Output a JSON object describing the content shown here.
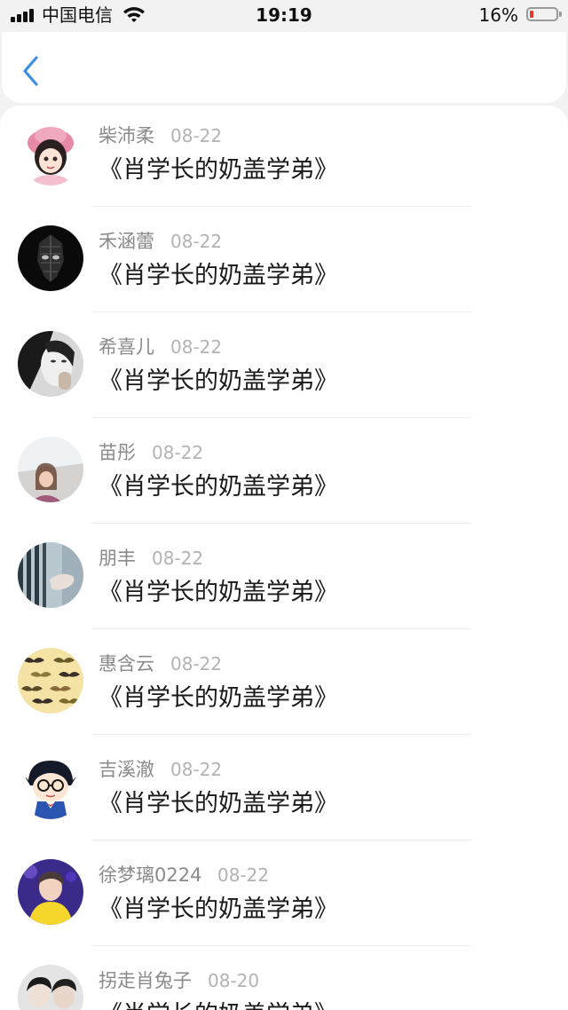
{
  "status_bar": {
    "carrier": "中国电信",
    "time": "19:19",
    "battery_percent": "16%",
    "battery_level": 0.16,
    "battery_color": "#e53935",
    "icons": [
      "signal-icon",
      "wifi-icon",
      "battery-icon"
    ]
  },
  "nav": {
    "back_icon": "chevron-left-icon",
    "accent_color": "#3a8ee6"
  },
  "items": [
    {
      "name": "柴沛柔",
      "date": "08-22",
      "content": "《肖学长的奶盖学弟》",
      "avatar": "cartoon-girl-pink-hat"
    },
    {
      "name": "禾涵蕾",
      "date": "08-22",
      "content": "《肖学长的奶盖学弟》",
      "avatar": "dark-mask-figure"
    },
    {
      "name": "希喜儿",
      "date": "08-22",
      "content": "《肖学长的奶盖学弟》",
      "avatar": "bw-portrait"
    },
    {
      "name": "苗彤",
      "date": "08-22",
      "content": "《肖学长的奶盖学弟》",
      "avatar": "girl-photo"
    },
    {
      "name": "朋丰",
      "date": "08-22",
      "content": "《肖学长的奶盖学弟》",
      "avatar": "hand-blinds-photo"
    },
    {
      "name": "惠含云",
      "date": "08-22",
      "content": "《肖学长的奶盖学弟》",
      "avatar": "mustache-pattern"
    },
    {
      "name": "吉溪澈",
      "date": "08-22",
      "content": "《肖学长的奶盖学弟》",
      "avatar": "cartoon-boy-glasses"
    },
    {
      "name": "徐梦璃0224",
      "date": "08-22",
      "content": "《肖学长的奶盖学弟》",
      "avatar": "yellow-shirt-boy"
    },
    {
      "name": "拐走肖兔子",
      "date": "08-20",
      "content": "《肖学长的奶盖学弟》",
      "avatar": "two-people-photo"
    }
  ]
}
